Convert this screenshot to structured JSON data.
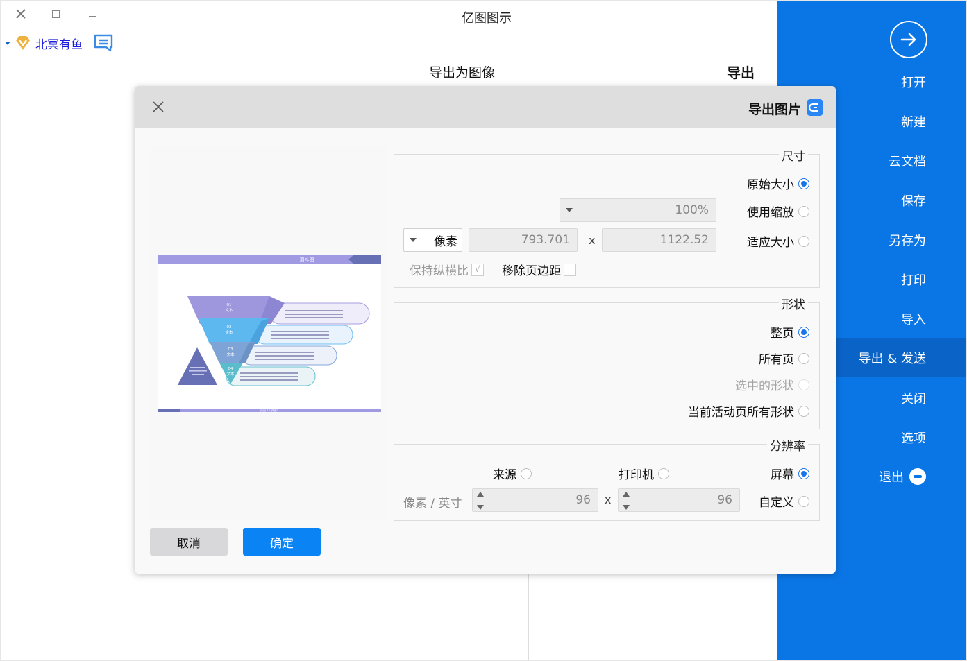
{
  "window": {
    "title": "亿图图示",
    "close_label": "×",
    "maximize_label": "",
    "minimize_label": ""
  },
  "user": {
    "name": "北冥有鱼",
    "badge_icon": "vip-diamond-icon",
    "message_icon": "message-icon"
  },
  "header": {
    "main_title": "导出",
    "sub_title": "导出为图像"
  },
  "sidebar": {
    "accent_color": "#0a76e6",
    "active_color": "#0a63c6",
    "items": [
      {
        "label": "打开",
        "icon": "arrow-right-circle-icon"
      },
      {
        "label": "新建"
      },
      {
        "label": "云文档"
      },
      {
        "label": "保存"
      },
      {
        "label": "另存为"
      },
      {
        "label": "打印"
      },
      {
        "label": "导入"
      },
      {
        "label": "导出 & 发送",
        "active": true
      },
      {
        "label": "关闭"
      },
      {
        "label": "选项"
      },
      {
        "label": "退出",
        "icon": "minus-circle-icon"
      }
    ]
  },
  "dialog": {
    "title": "导出图片",
    "size": {
      "legend": "尺寸",
      "options": [
        {
          "label": "原始大小",
          "checked": true
        },
        {
          "label": "使用缩放",
          "checked": false
        },
        {
          "label": "适应大小",
          "checked": false
        }
      ],
      "zoom_value": "100%",
      "width_value": "1122.52",
      "height_value": "793.701",
      "x_label": "x",
      "unit_value": "像素",
      "remove_margin_label": "移除页边距",
      "remove_margin_checked": false,
      "keep_ratio_label": "保持纵横比",
      "keep_ratio_checked": true,
      "keep_ratio_mark": "√"
    },
    "shape": {
      "legend": "形状",
      "options": [
        {
          "label": "整页",
          "checked": true,
          "disabled": false
        },
        {
          "label": "所有页",
          "checked": false,
          "disabled": false
        },
        {
          "label": "选中的形状",
          "checked": false,
          "disabled": true
        },
        {
          "label": "当前活动页所有形状",
          "checked": false,
          "disabled": false
        }
      ]
    },
    "resolution": {
      "legend": "分辨率",
      "options": [
        {
          "label": "屏幕",
          "checked": true
        },
        {
          "label": "打印机",
          "checked": false
        },
        {
          "label": "来源",
          "checked": false
        },
        {
          "label": "自定义",
          "checked": false
        }
      ],
      "dpi_x": "96",
      "dpi_y": "96",
      "x_label": "x",
      "unit": "像素 / 英寸"
    },
    "preview": {
      "slide_title": "漏斗图",
      "footer_text": "页面 1 / 页面1",
      "levels": [
        {
          "num": "01",
          "label": "文本",
          "color": "#9f97de"
        },
        {
          "num": "02",
          "label": "文本",
          "color": "#5db8f0"
        },
        {
          "num": "03",
          "label": "文本",
          "color": "#7ea3d6"
        },
        {
          "num": "04",
          "label": "文本",
          "color": "#5bbccc"
        }
      ]
    },
    "ok_label": "确定",
    "cancel_label": "取消"
  }
}
